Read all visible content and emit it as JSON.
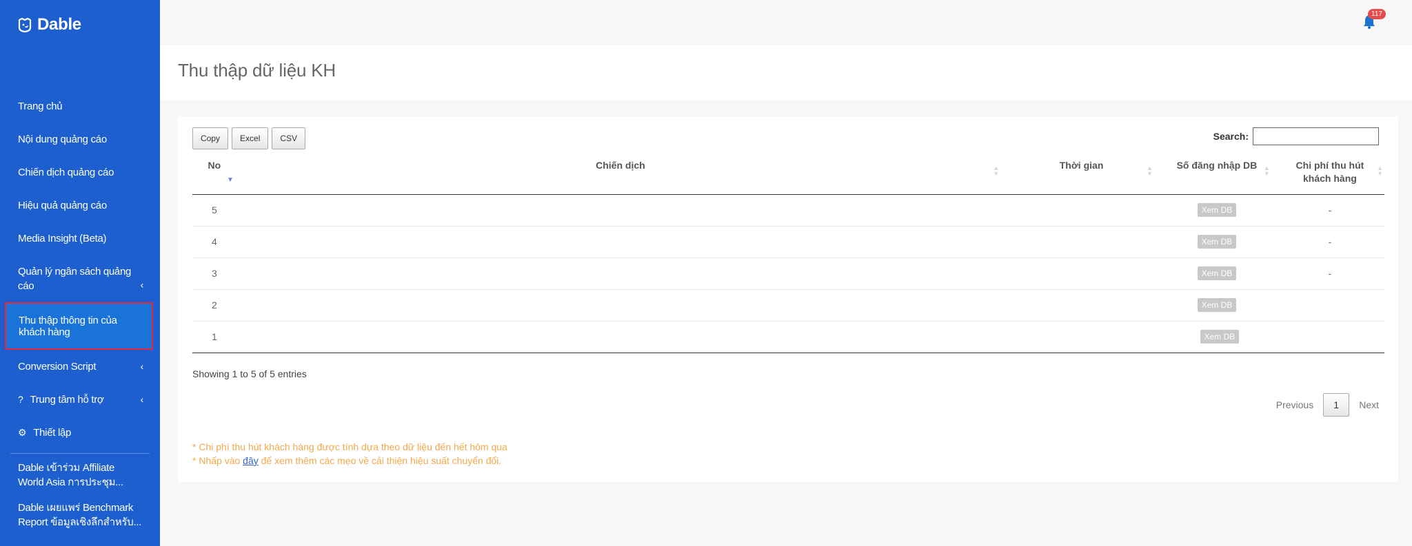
{
  "app": {
    "logo_text": "Dable"
  },
  "sidebar": {
    "items": [
      {
        "label": "Trang chủ"
      },
      {
        "label": "Nội dung quảng cáo"
      },
      {
        "label": "Chiến dịch quảng cáo"
      },
      {
        "label": "Hiệu quả quảng cáo"
      },
      {
        "label": "Media Insight (Beta)"
      },
      {
        "label": "Quản lý ngân sách quảng cáo",
        "chevron": "‹"
      },
      {
        "label": "Thu thập thông tin của khách hàng",
        "active": true
      },
      {
        "label": "Conversion Script",
        "chevron": "‹"
      },
      {
        "label": "Trung tâm hỗ trợ",
        "chevron": "‹",
        "icon": "question-icon",
        "icon_glyph": "?"
      },
      {
        "label": "Thiết lập",
        "icon": "gear-icon",
        "icon_glyph": "⚙"
      }
    ],
    "news": [
      {
        "label": "Dable เข้าร่วม Affiliate World Asia การประชุม..."
      },
      {
        "label": "Dable เผยแพร่ Benchmark Report ข้อมูลเชิงลึกสำหรับ..."
      }
    ]
  },
  "header": {
    "notification_count": "117"
  },
  "page": {
    "title": "Thu thập dữ liệu KH"
  },
  "toolbar": {
    "copy_label": "Copy",
    "excel_label": "Excel",
    "csv_label": "CSV"
  },
  "search": {
    "label": "Search:",
    "value": ""
  },
  "table": {
    "headers": {
      "no": "No",
      "campaign": "Chiến dịch",
      "time": "Thời gian",
      "db_count": "Số đăng nhập DB",
      "cost": "Chi phí thu hút khách hàng"
    },
    "rows": [
      {
        "no": "5",
        "campaign": "",
        "time": "",
        "db": "Xem DB",
        "cost": "-"
      },
      {
        "no": "4",
        "campaign": "",
        "time": "",
        "db": "Xem DB",
        "cost": "-"
      },
      {
        "no": "3",
        "campaign": "",
        "time": "",
        "db": "Xem DB",
        "cost": "-"
      },
      {
        "no": "2",
        "campaign": "",
        "time": "",
        "db": "Xem DB",
        "cost": ""
      },
      {
        "no": "1",
        "campaign": "",
        "time": "",
        "db": "Xem DB",
        "cost": ""
      }
    ]
  },
  "table_info": "Showing 1 to 5 of 5 entries",
  "pagination": {
    "previous": "Previous",
    "current": "1",
    "next": "Next"
  },
  "notes": {
    "line1": "* Chi phí thu hút khách hàng được tính dựa theo dữ liệu đến hết hôm qua",
    "line2_prefix": "* Nhấp vào ",
    "line2_link": "đây",
    "line2_suffix": " để xem thêm các mẹo về cải thiện hiệu suất chuyển đổi."
  },
  "colors": {
    "sidebar_bg": "#1d5fce",
    "active_bg": "#1a73d8",
    "active_border": "#e3283a",
    "note_text": "#f3a84a",
    "badge": "#e54b4b"
  }
}
